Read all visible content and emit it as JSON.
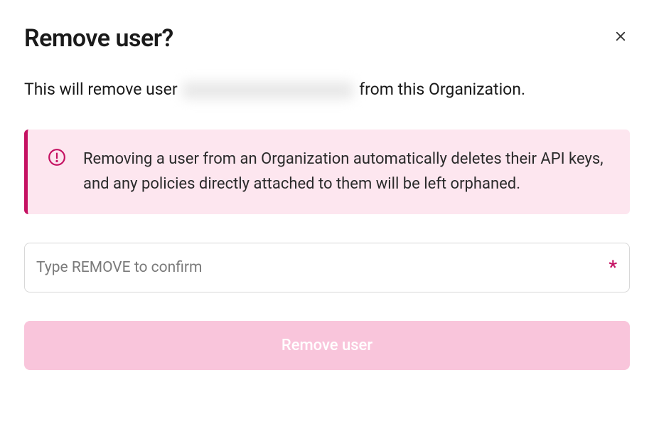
{
  "dialog": {
    "title": "Remove user?",
    "description_prefix": "This will remove user ",
    "description_suffix": " from this Organization."
  },
  "warning": {
    "text": "Removing a user from an Organization automatically deletes their API keys, and any policies directly attached to them will be left orphaned."
  },
  "confirm_input": {
    "placeholder": "Type REMOVE to confirm",
    "value": "",
    "required_marker": "*"
  },
  "actions": {
    "remove_label": "Remove user"
  },
  "colors": {
    "accent": "#c51162",
    "warning_bg": "#fde6ef",
    "button_disabled_bg": "#f9c5db"
  }
}
